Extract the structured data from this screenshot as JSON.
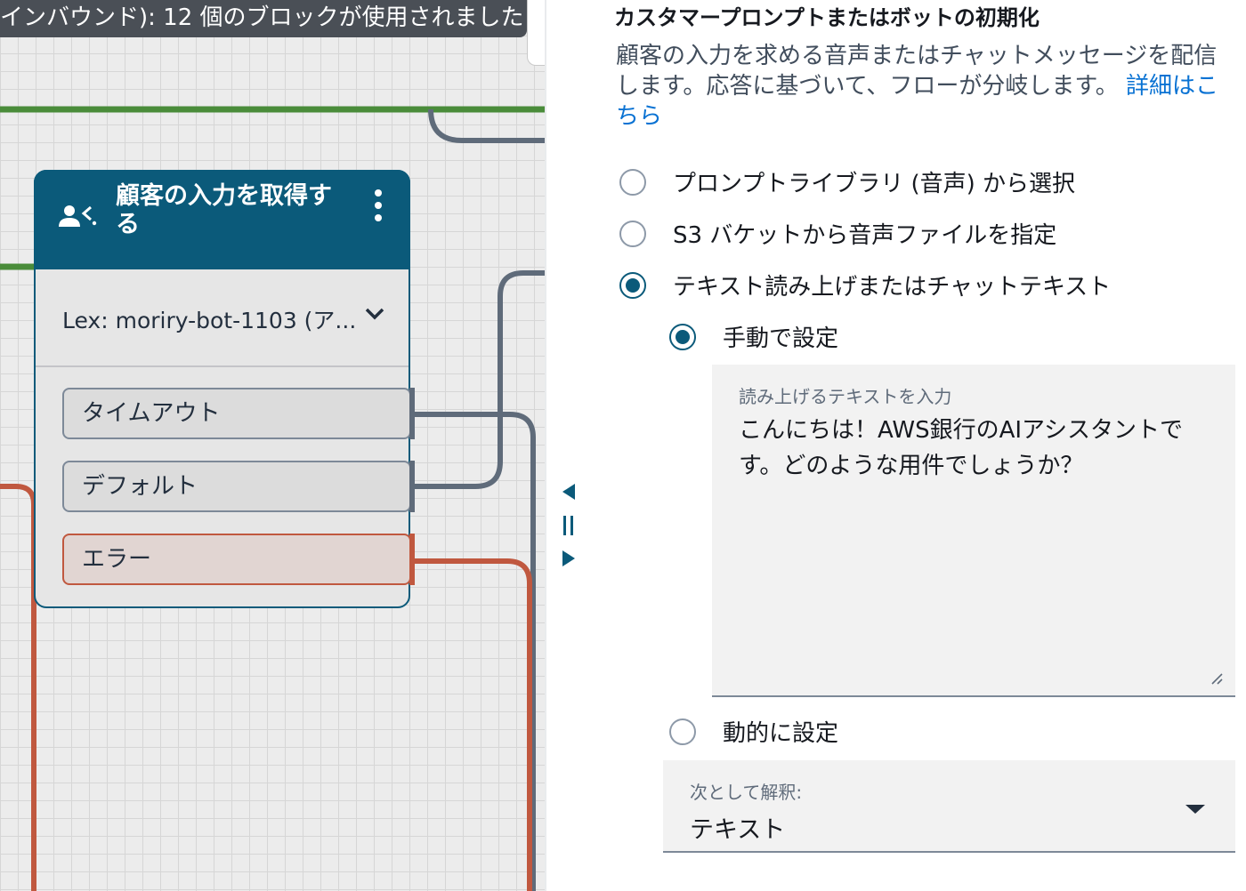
{
  "canvas": {
    "banner_text": "インバウンド): 12 個のブロックが使用されました",
    "block": {
      "title": "顧客の入力を取得する",
      "icon": "get-customer-input-icon",
      "lex_bot": "Lex: moriry-bot-1103 (ア...",
      "branches": [
        "タイムアウト",
        "デフォルト",
        "エラー"
      ]
    },
    "colors": {
      "block_header": "#0b5a7a",
      "connector_success": "#4a8c3a",
      "connector_default": "#5f6b7a",
      "connector_error": "#c0583f"
    }
  },
  "panel": {
    "heading": "カスタマープロンプトまたはボットの初期化",
    "description": "顧客の入力を求める音声またはチャットメッセージを配信します。応答に基づいて、フローが分岐します。",
    "learn_more": "詳細はこちら",
    "prompt_options": [
      {
        "label": "プロンプトライブラリ (音声) から選択",
        "checked": false
      },
      {
        "label": "S3 バケットから音声ファイルを指定",
        "checked": false
      },
      {
        "label": "テキスト読み上げまたはチャットテキスト",
        "checked": true
      }
    ],
    "set_manually": {
      "label": "手動で設定",
      "checked": true
    },
    "text_input": {
      "label": "読み上げるテキストを入力",
      "value": "こんにちは！AWS銀行のAIアシスタントです。どのような用件でしょうか？"
    },
    "set_dynamically": {
      "label": "動的に設定",
      "checked": false
    },
    "interpret_as": {
      "label": "次として解釈:",
      "value": "テキスト"
    },
    "link_color": "#0972d3"
  }
}
